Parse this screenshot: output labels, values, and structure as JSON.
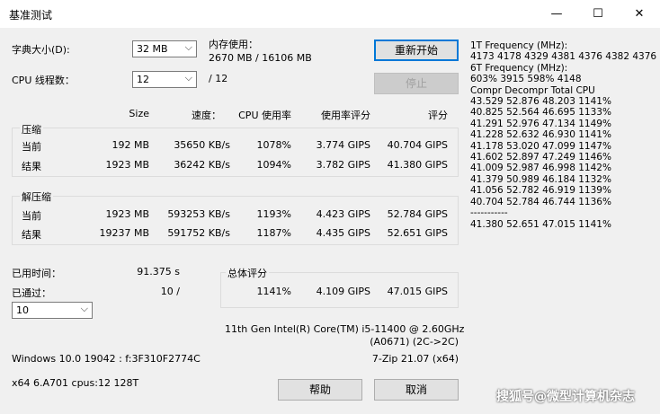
{
  "window": {
    "title": "基准测试",
    "minimize": "—",
    "maximize": "☐",
    "close": "✕"
  },
  "dictionary": {
    "label": "字典大小(D):",
    "value": "32 MB"
  },
  "memory": {
    "label": "内存使用：",
    "value": "2670 MB / 16106 MB"
  },
  "threads": {
    "label": "CPU 线程数：",
    "value": "12",
    "total": "/ 12"
  },
  "buttons": {
    "restart": "重新开始",
    "stop": "停止",
    "help": "帮助",
    "cancel": "取消"
  },
  "headers": {
    "size": "Size",
    "speed": "速度：",
    "cpu_usage": "CPU 使用率",
    "rating_usage": "使用率评分",
    "rating": "评分"
  },
  "compress": {
    "title": "压缩",
    "current": {
      "label": "当前",
      "size": "192 MB",
      "speed": "35650 KB/s",
      "cpu": "1078%",
      "rpu": "3.774 GIPS",
      "rating": "40.704 GIPS"
    },
    "result": {
      "label": "结果",
      "size": "1923 MB",
      "speed": "36242 KB/s",
      "cpu": "1094%",
      "rpu": "3.782 GIPS",
      "rating": "41.380 GIPS"
    }
  },
  "decompress": {
    "title": "解压缩",
    "current": {
      "label": "当前",
      "size": "1923 MB",
      "speed": "593253 KB/s",
      "cpu": "1193%",
      "rpu": "4.423 GIPS",
      "rating": "52.784 GIPS"
    },
    "result": {
      "label": "结果",
      "size": "19237 MB",
      "speed": "591752 KB/s",
      "cpu": "1187%",
      "rpu": "4.435 GIPS",
      "rating": "52.651 GIPS"
    }
  },
  "elapsed": {
    "label": "已用时间：",
    "value": "91.375 s"
  },
  "passes": {
    "label": "已通过：",
    "value": "10 /",
    "select": "10"
  },
  "total": {
    "title": "总体评分",
    "cpu": "1141%",
    "rpu": "4.109 GIPS",
    "rating": "47.015 GIPS"
  },
  "cpu_info": {
    "line1": "11th Gen Intel(R) Core(TM) i5-11400 @ 2.60GHz",
    "line2": "(A0671) (2C->2C)"
  },
  "sys": {
    "os": "Windows 10.0 19042 : f:3F310F2774C",
    "version": "7-Zip 21.07 (x64)",
    "arch": "x64 6.A701 cpus:12 128T"
  },
  "log": {
    "lines": [
      "1T Frequency (MHz):",
      " 4173 4178 4329 4381 4376 4382 4376",
      "6T Frequency (MHz):",
      " 603% 3915 598% 4148",
      "Compr Decompr Total   CPU",
      "43.529  52.876  48.203  1141%",
      "40.825  52.564  46.695  1133%",
      "41.291  52.976  47.134  1149%",
      "41.228  52.632  46.930  1141%",
      "41.178  53.020  47.099  1147%",
      "41.602  52.897  47.249  1146%",
      "41.009  52.987  46.998  1142%",
      "41.379  50.989  46.184  1132%",
      "41.056  52.782  46.919  1139%",
      "40.704  52.784  46.744  1136%",
      "-----------",
      "41.380  52.651  47.015  1141%"
    ]
  },
  "watermark": "搜狐号@微型计算机杂志"
}
